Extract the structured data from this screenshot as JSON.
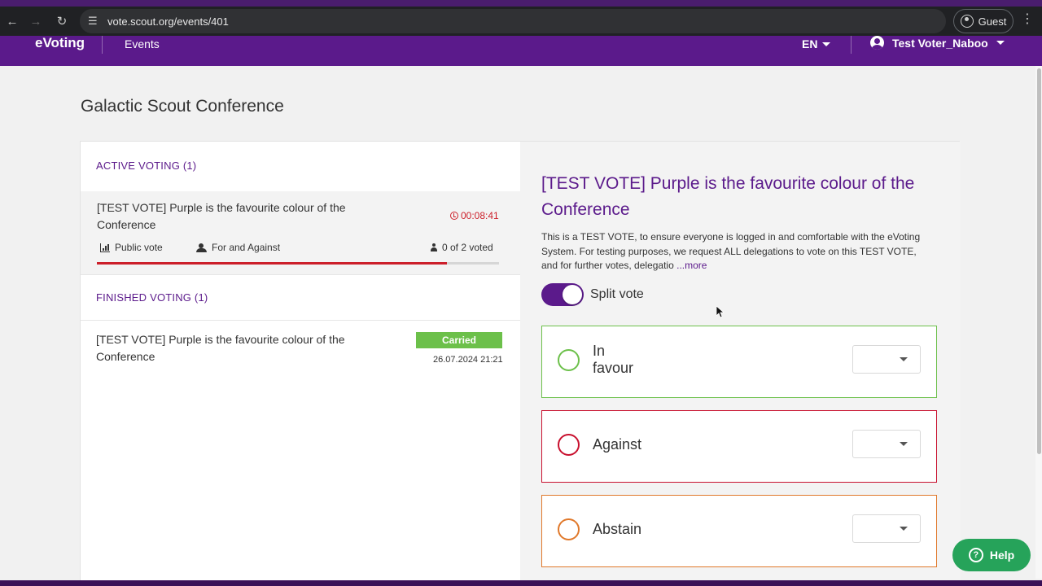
{
  "browser": {
    "url": "vote.scout.org/events/401",
    "profile_label": "Guest"
  },
  "header": {
    "brand": "eVoting",
    "nav_events": "Events",
    "language": "EN",
    "user_name": "Test Voter_Naboo"
  },
  "page": {
    "title": "Galactic Scout Conference"
  },
  "active_section": {
    "heading": "ACTIVE VOTING (1)",
    "item": {
      "title": "[TEST VOTE] Purple is the favourite colour of the Conference",
      "timer": "00:08:41",
      "vote_type": "Public vote",
      "options_type": "For and Against",
      "voted_count": "0 of 2 voted",
      "time_remaining_fraction": 0.87
    }
  },
  "finished_section": {
    "heading": "FINISHED VOTING (1)",
    "item": {
      "title": "[TEST VOTE] Purple is the favourite colour of the Conference",
      "result": "Carried",
      "date": "26.07.2024 21:21"
    }
  },
  "motion": {
    "title": "[TEST VOTE] Purple is the favourite colour of the Conference",
    "description": "This is a TEST VOTE, to ensure everyone is logged in and comfortable with the eVoting System. For testing purposes, we request ALL delegations to vote on this TEST VOTE, and for further votes, delegatio",
    "more_label": "...more",
    "split_vote_label": "Split vote",
    "split_vote_on": true
  },
  "options": [
    {
      "label": "In favour",
      "color": "#6cc04a"
    },
    {
      "label": "Against",
      "color": "#c8102e"
    },
    {
      "label": "Abstain",
      "color": "#e0782a"
    }
  ],
  "help": {
    "label": "Help"
  },
  "colors": {
    "brand_purple": "#5b1a8b",
    "timer_red": "#cc1f2a",
    "carried_green": "#6cc04a",
    "help_green": "#26a35a"
  }
}
